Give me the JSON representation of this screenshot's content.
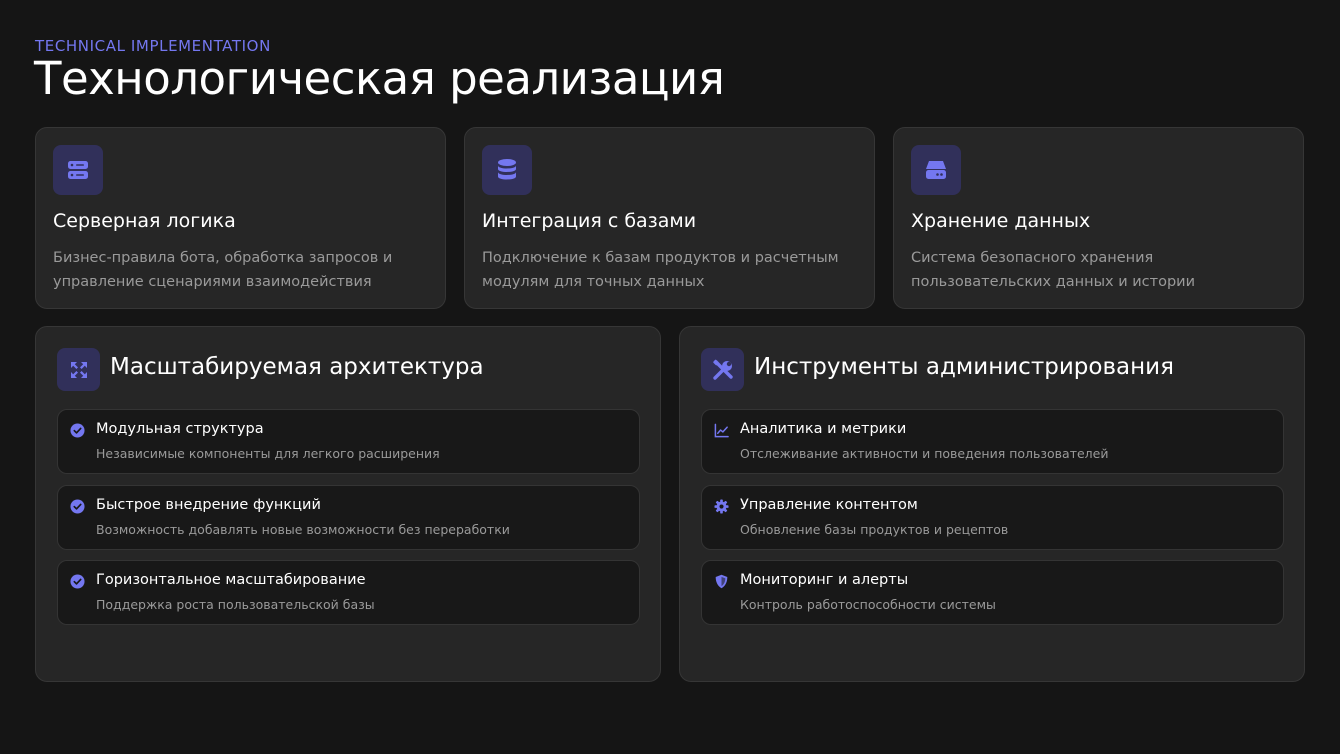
{
  "header": {
    "subtitle": "TECHNICAL IMPLEMENTATION",
    "title": "Технологическая реализация"
  },
  "accent_color": "#7477f0",
  "top_cards": [
    {
      "icon": "server-icon",
      "title": "Серверная логика",
      "description": "Бизнес-правила бота, обработка запросов и управление сценариями взаимодействия"
    },
    {
      "icon": "database-icon",
      "title": "Интеграция с базами",
      "description": "Подключение к базам продуктов и расчетным модулям для точных данных"
    },
    {
      "icon": "storage-icon",
      "title": "Хранение данных",
      "description": "Система безопасного хранения пользовательских данных и истории"
    }
  ],
  "architecture": {
    "icon": "expand-arrows-icon",
    "title": "Масштабируемая архитектура",
    "items": [
      {
        "icon": "check-circle-icon",
        "title": "Модульная структура",
        "description": "Независимые компоненты для легкого расширения"
      },
      {
        "icon": "check-circle-icon",
        "title": "Быстрое внедрение функций",
        "description": "Возможность добавлять новые возможности без переработки"
      },
      {
        "icon": "check-circle-icon",
        "title": "Горизонтальное масштабирование",
        "description": "Поддержка роста пользовательской базы"
      }
    ]
  },
  "admin_tools": {
    "icon": "tools-icon",
    "title": "Инструменты администрирования",
    "items": [
      {
        "icon": "line-chart-icon",
        "title": "Аналитика и метрики",
        "description": "Отслеживание активности и поведения пользователей"
      },
      {
        "icon": "gear-icon",
        "title": "Управление контентом",
        "description": "Обновление базы продуктов и рецептов"
      },
      {
        "icon": "shield-icon",
        "title": "Мониторинг и алерты",
        "description": "Контроль работоспособности системы"
      }
    ]
  }
}
